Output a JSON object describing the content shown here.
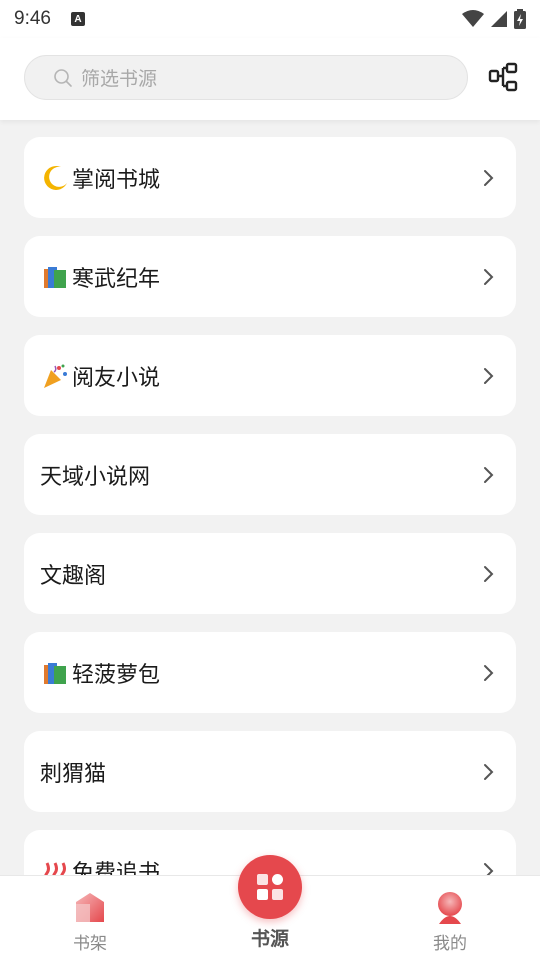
{
  "status_bar": {
    "time": "9:46",
    "a_badge": "A"
  },
  "search": {
    "placeholder": "筛选书源"
  },
  "sources": [
    {
      "label": "掌阅书城",
      "emoji": "moon-emoji"
    },
    {
      "label": "寒武纪年",
      "emoji": "books-emoji"
    },
    {
      "label": "阅友小说",
      "emoji": "party-popper-emoji"
    },
    {
      "label": "天域小说网",
      "emoji": ""
    },
    {
      "label": "文趣阁",
      "emoji": ""
    },
    {
      "label": "轻菠萝包",
      "emoji": "books-emoji"
    },
    {
      "label": "刺猬猫",
      "emoji": ""
    },
    {
      "label": "免费追书",
      "emoji": "hot-springs-emoji"
    }
  ],
  "nav": {
    "shelf_label": "书架",
    "source_label": "书源",
    "mine_label": "我的"
  },
  "colors": {
    "accent": "#e5484d",
    "background": "#f2f2f2"
  }
}
